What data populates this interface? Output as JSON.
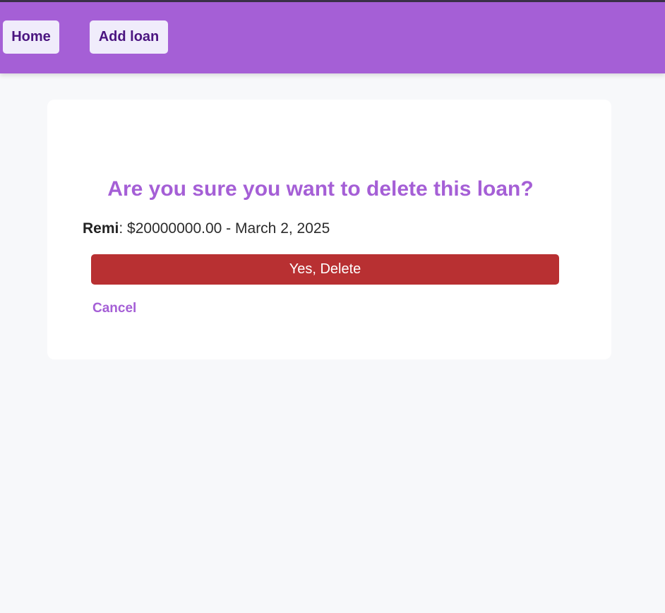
{
  "nav": {
    "home_label": "Home",
    "add_loan_label": "Add loan"
  },
  "dialog": {
    "title": "Are you sure you want to delete this loan?",
    "loan": {
      "name": "Remi",
      "separator": ": ",
      "amount": "$20000000.00",
      "dash": " - ",
      "date": "March 2, 2025"
    },
    "confirm_label": "Yes, Delete",
    "cancel_label": "Cancel"
  },
  "colors": {
    "brand": "#a55fd6",
    "danger": "#b83032",
    "nav_button_bg": "#f0ecfb",
    "nav_button_text": "#4b1580",
    "page_bg": "#f7f8fa"
  }
}
